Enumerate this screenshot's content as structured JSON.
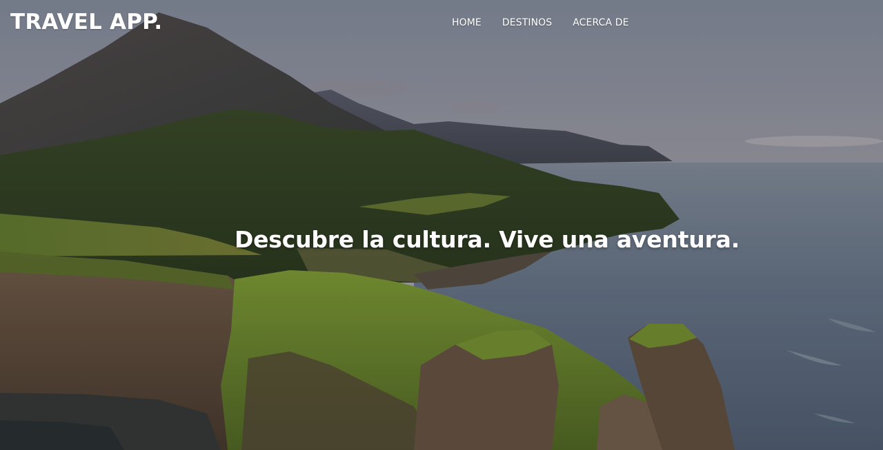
{
  "header": {
    "logo": "TRAVEL APP."
  },
  "nav": {
    "items": [
      {
        "label": "HOME"
      },
      {
        "label": "DESTINOS"
      },
      {
        "label": "ACERCA DE"
      }
    ]
  },
  "hero": {
    "headline": "Descubre la cultura. Vive una aventura.",
    "background_description_icon": "coastal-mountain-landscape"
  },
  "colors": {
    "text": "#ffffff",
    "sky_top": "#8f96a6",
    "sky_bottom": "#c4c0c3",
    "sea": "#6e7f92",
    "grass": "#7d9c3b",
    "cliff": "#6a5443"
  }
}
